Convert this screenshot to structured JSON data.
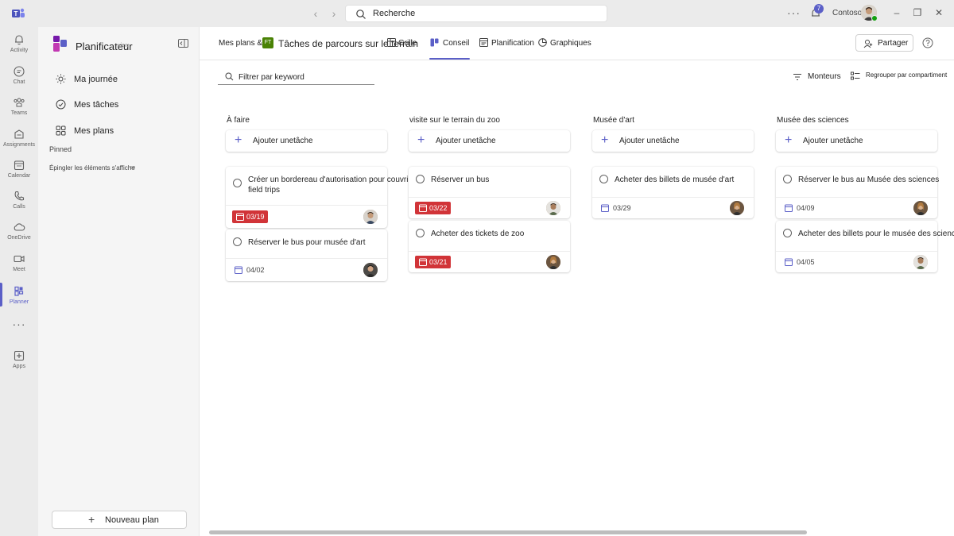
{
  "titlebar": {
    "search_placeholder": "Recherche",
    "org": "Contoso",
    "notification_count": "7",
    "more_label": "···"
  },
  "rail": {
    "items": [
      {
        "label": "Activity",
        "icon": "bell-icon"
      },
      {
        "label": "Chat",
        "icon": "chat-icon"
      },
      {
        "label": "Teams",
        "icon": "teams-icon"
      },
      {
        "label": "Assignments",
        "icon": "assignments-icon"
      },
      {
        "label": "Calendar",
        "icon": "calendar-icon"
      },
      {
        "label": "Calls",
        "icon": "phone-icon"
      },
      {
        "label": "OneDrive",
        "icon": "cloud-icon"
      },
      {
        "label": "Meet",
        "icon": "video-icon"
      },
      {
        "label": "Planner",
        "icon": "planner-icon"
      },
      {
        "label": "Apps",
        "icon": "apps-icon"
      }
    ],
    "more": "···",
    "active": "Planner"
  },
  "sidebar": {
    "title": "Planificateur",
    "title_overlay": "view",
    "nav": [
      {
        "label": "Ma journée",
        "icon": "sun-icon"
      },
      {
        "label": "Mes tâches",
        "icon": "check-circle-icon"
      },
      {
        "label": "Mes plans",
        "icon": "grid-icon"
      }
    ],
    "pinned_label": "Pinned",
    "pin_hint": "Épingler les éléments s'affiche",
    "pin_hint_overlay": "re",
    "new_plan": "Nouveau plan"
  },
  "topnav": {
    "my_plans": "Mes plans &g",
    "plan_initials": "FT",
    "plan_title": "Tâches de parcours sur le terrain",
    "tabs": [
      "Grille",
      "Conseil",
      "Planification",
      "Graphiques"
    ],
    "active_tab": "Conseil",
    "share": "Partager"
  },
  "toolbar": {
    "filter_placeholder": "Filtrer par keyword",
    "filters": "Monteurs",
    "group_by": "Regrouper par compartiment"
  },
  "board": {
    "add_task_label": "Ajouter unetâche",
    "buckets": [
      {
        "title": "À faire",
        "tasks": [
          {
            "title_lines": [
              "Créer un bordereau d'autorisation pour couvrir tout",
              "field trips"
            ],
            "due": "03/19",
            "overdue": true
          },
          {
            "title_lines": [
              "Réserver le bus pour musée d'art"
            ],
            "due": "04/02",
            "overdue": false
          }
        ]
      },
      {
        "title": "visite sur le terrain du zoo",
        "tasks": [
          {
            "title_lines": [
              "Réserver un bus"
            ],
            "due": "03/22",
            "overdue": true
          },
          {
            "title_lines": [
              "Acheter des tickets de zoo"
            ],
            "due": "03/21",
            "overdue": true
          }
        ]
      },
      {
        "title": "Musée d'art",
        "tasks": [
          {
            "title_lines": [
              "Acheter des billets de musée d'art"
            ],
            "due": "03/29",
            "overdue": false
          }
        ]
      },
      {
        "title": "Musée des sciences",
        "tasks": [
          {
            "title_lines": [
              "Réserver le bus au Musée des sciences"
            ],
            "due": "04/09",
            "overdue": false
          },
          {
            "title_lines": [
              "Acheter des billets pour le musée des sciences"
            ],
            "due": "04/05",
            "overdue": false
          }
        ]
      }
    ]
  },
  "colors": {
    "accent": "#5b5fc7",
    "overdue": "#d13438",
    "plan_badge": "#498205"
  }
}
